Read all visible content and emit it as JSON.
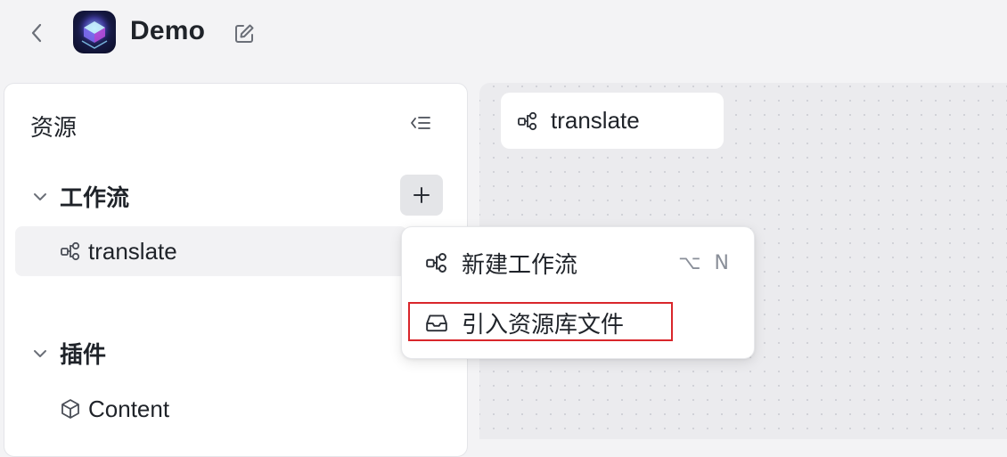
{
  "header": {
    "app_title": "Demo",
    "back_icon": "chevron-left-icon",
    "edit_icon": "edit-icon"
  },
  "sidebar": {
    "title": "资源",
    "collapse_icon": "collapse-list-icon",
    "sections": [
      {
        "label": "工作流",
        "items": [
          {
            "label": "translate",
            "icon": "workflow-icon"
          }
        ]
      },
      {
        "label": "插件",
        "items": [
          {
            "label": "Content",
            "icon": "cube-icon"
          }
        ]
      }
    ]
  },
  "canvas": {
    "tab_label": "translate"
  },
  "menu": {
    "items": [
      {
        "label": "新建工作流",
        "icon": "workflow-icon",
        "shortcut": "⌥ N"
      },
      {
        "label": "引入资源库文件",
        "icon": "inbox-icon",
        "shortcut": ""
      }
    ]
  },
  "colors": {
    "highlight": "#d9262b",
    "background": "#f3f3f5"
  }
}
